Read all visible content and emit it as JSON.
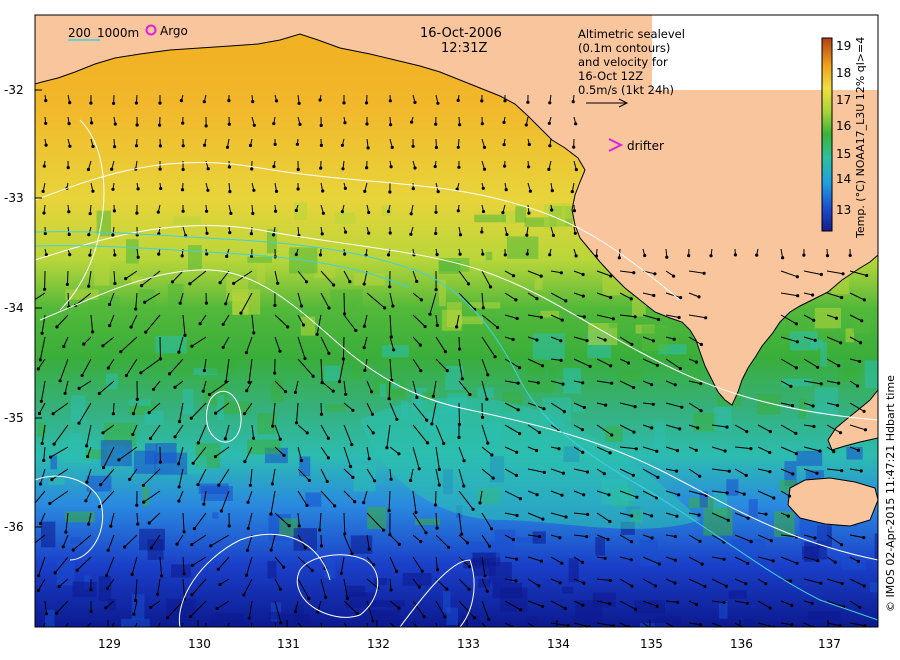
{
  "map": {
    "date": "16-Oct-2006",
    "time": "12:31Z",
    "isobath_labels": [
      "200",
      "1000m"
    ],
    "argo_label": "Argo",
    "altimetry_lines": [
      "Altimetric sealevel",
      "(0.1m contours)",
      "and velocity for",
      "16-Oct 12Z"
    ],
    "speed_label": "0.5m/s (1kt 24h)",
    "drifter_label": "drifter",
    "colorbar_title": "Temp. (°C) NOAA17_L3U 12% ql>=4",
    "colorbar_ticks": [
      "13",
      "14",
      "15",
      "16",
      "17",
      "18",
      "19"
    ],
    "credit": "© IMOS 02-Apr-2015 11:47:21 Hdbart time",
    "lat_ticks": [
      "-32",
      "-33",
      "-34",
      "-35",
      "-36"
    ],
    "lon_ticks": [
      "129",
      "130",
      "131",
      "132",
      "133",
      "134",
      "135",
      "136",
      "137"
    ],
    "colors": {
      "land": "#f9c59c",
      "sst_warm": "#f2a21c",
      "sst_yellow": "#e8d23a",
      "sst_green": "#3aae3a",
      "sst_cyan": "#2cc0b0",
      "sst_blue": "#1a4fd0",
      "sst_deep": "#0a1a8a",
      "isobath_200": "#40d0e0",
      "argo": "#e020e0",
      "drifter": "#e020e0"
    }
  }
}
